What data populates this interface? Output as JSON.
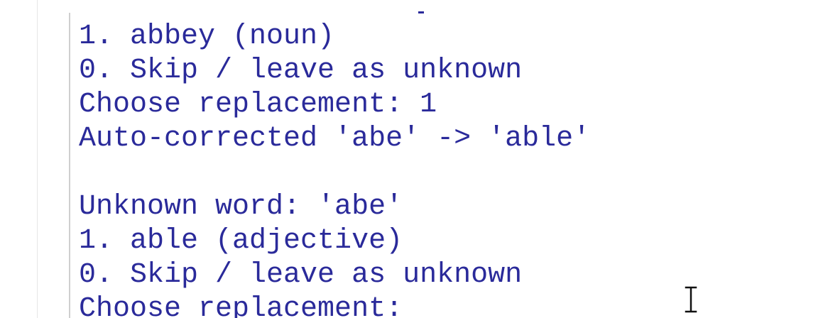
{
  "console": {
    "lines": [
      "1. abbey (noun)",
      "0. Skip / leave as unknown",
      "Choose replacement: 1",
      "Auto-corrected 'abe' -> 'able'",
      "",
      "Unknown word: 'abe'",
      "1. able (adjective)",
      "0. Skip / leave as unknown",
      "Choose replacement:"
    ]
  },
  "colors": {
    "text": "#2a2a9a",
    "background": "#ffffff"
  },
  "icons": {
    "cursor": "i-beam-cursor-icon"
  }
}
